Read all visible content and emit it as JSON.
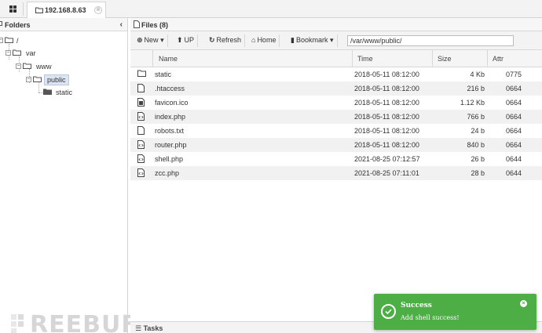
{
  "tab": {
    "title": "192.168.8.63",
    "close": "⊗"
  },
  "folders_panel": {
    "title": "Folders",
    "tree": [
      {
        "label": "/",
        "expander": "−"
      },
      {
        "label": "var",
        "expander": "−"
      },
      {
        "label": "www",
        "expander": "−"
      },
      {
        "label": "public",
        "expander": "−",
        "selected": true
      },
      {
        "label": "static"
      }
    ]
  },
  "files_panel": {
    "title": "Files (8)",
    "toolbar": {
      "new": "New",
      "up": "UP",
      "refresh": "Refresh",
      "home": "Home",
      "bookmark": "Bookmark",
      "path": "/var/www/public/"
    },
    "columns": {
      "name": "Name",
      "time": "Time",
      "size": "Size",
      "attr": "Attr"
    },
    "files": [
      {
        "icon": "folder-icon",
        "name": "static",
        "time": "2018-05-11 08:12:00",
        "size": "4 Kb",
        "attr": "0775"
      },
      {
        "icon": "file-icon",
        "name": ".htaccess",
        "time": "2018-05-11 08:12:00",
        "size": "216 b",
        "attr": "0664"
      },
      {
        "icon": "image-file-icon",
        "name": "favicon.ico",
        "time": "2018-05-11 08:12:00",
        "size": "1.12 Kb",
        "attr": "0664"
      },
      {
        "icon": "code-file-icon",
        "name": "index.php",
        "time": "2018-05-11 08:12:00",
        "size": "766 b",
        "attr": "0664"
      },
      {
        "icon": "file-icon",
        "name": "robots.txt",
        "time": "2018-05-11 08:12:00",
        "size": "24 b",
        "attr": "0664"
      },
      {
        "icon": "code-file-icon",
        "name": "router.php",
        "time": "2018-05-11 08:12:00",
        "size": "840 b",
        "attr": "0664"
      },
      {
        "icon": "code-file-icon",
        "name": "shell.php",
        "time": "2021-08-25 07:12:57",
        "size": "26 b",
        "attr": "0644"
      },
      {
        "icon": "code-file-icon",
        "name": "zcc.php",
        "time": "2021-08-25 07:11:01",
        "size": "28 b",
        "attr": "0644"
      }
    ]
  },
  "tasks": {
    "label": "Tasks"
  },
  "watermark": {
    "text": "REEBUF"
  },
  "toast": {
    "title": "Success",
    "message": "Add shell success!",
    "color": "#4dae45"
  }
}
